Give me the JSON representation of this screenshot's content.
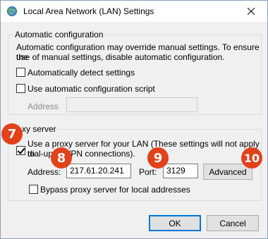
{
  "window": {
    "title": "Local Area Network (LAN) Settings",
    "close_icon": "close-icon"
  },
  "auto_config": {
    "legend": "Automatic configuration",
    "description_line1": "Automatic configuration may override manual settings.  To ensure the",
    "description_line2": "use of manual settings, disable automatic configuration.",
    "detect_label": "Automatically detect settings",
    "detect_checked": false,
    "script_label": "Use automatic configuration script",
    "script_checked": false,
    "address_label": "Address",
    "address_value": ""
  },
  "proxy": {
    "legend": "xy server",
    "use_proxy_line1": "Use a proxy server for your LAN (These settings will not apply to",
    "use_proxy_line2": "dial-up or VPN connections).",
    "use_proxy_checked": true,
    "address_label": "Address:",
    "address_value": "217.61.20.241",
    "port_label": "Port:",
    "port_value": "3129",
    "advanced_label": "Advanced",
    "bypass_label": "Bypass proxy server for local addresses",
    "bypass_checked": false
  },
  "buttons": {
    "ok_label": "OK",
    "cancel_label": "Cancel"
  },
  "annotations": {
    "badge_7": "7",
    "badge_8": "8",
    "badge_9": "9",
    "badge_10": "10",
    "color": "#e2411a"
  }
}
